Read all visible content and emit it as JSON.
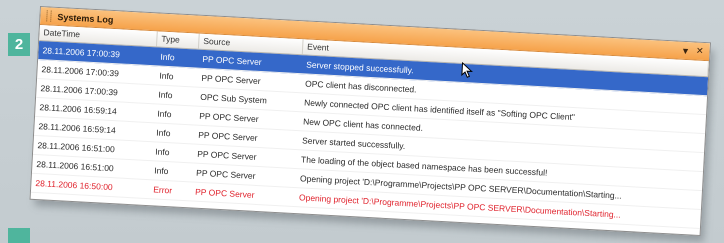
{
  "step_badge": "2",
  "window": {
    "title": "Systems Log",
    "pin_icon": "pin-icon",
    "close_icon": "close-icon"
  },
  "columns": {
    "datetime": "DateTime",
    "type": "Type",
    "source": "Source",
    "event": "Event"
  },
  "rows": [
    {
      "datetime": "28.11.2006 17:00:39",
      "type": "Info",
      "source": "PP OPC Server",
      "event": "Server stopped successfully.",
      "state": "selected"
    },
    {
      "datetime": "28.11.2006 17:00:39",
      "type": "Info",
      "source": "PP OPC Server",
      "event": "OPC client has disconnected.",
      "state": "normal"
    },
    {
      "datetime": "28.11.2006 17:00:39",
      "type": "Info",
      "source": "OPC Sub System",
      "event": "Newly connected OPC client has identified itself as \"Softing OPC Client\"",
      "state": "normal"
    },
    {
      "datetime": "28.11.2006 16:59:14",
      "type": "Info",
      "source": "PP OPC Server",
      "event": "New OPC client has connected.",
      "state": "normal"
    },
    {
      "datetime": "28.11.2006 16:59:14",
      "type": "Info",
      "source": "PP OPC Server",
      "event": "Server started successfully.",
      "state": "normal"
    },
    {
      "datetime": "28.11.2006 16:51:00",
      "type": "Info",
      "source": "PP OPC Server",
      "event": "The loading of the object based namespace has been successful!",
      "state": "normal"
    },
    {
      "datetime": "28.11.2006 16:51:00",
      "type": "Info",
      "source": "PP OPC Server",
      "event": "Opening project 'D:\\Programme\\Projects\\PP OPC SERVER\\Documentation\\Starting...",
      "state": "normal"
    },
    {
      "datetime": "28.11.2006 16:50:00",
      "type": "Error",
      "source": "PP OPC Server",
      "event": "Opening project 'D:\\Programme\\Projects\\PP OPC SERVER\\Documentation\\Starting...",
      "state": "error"
    }
  ]
}
